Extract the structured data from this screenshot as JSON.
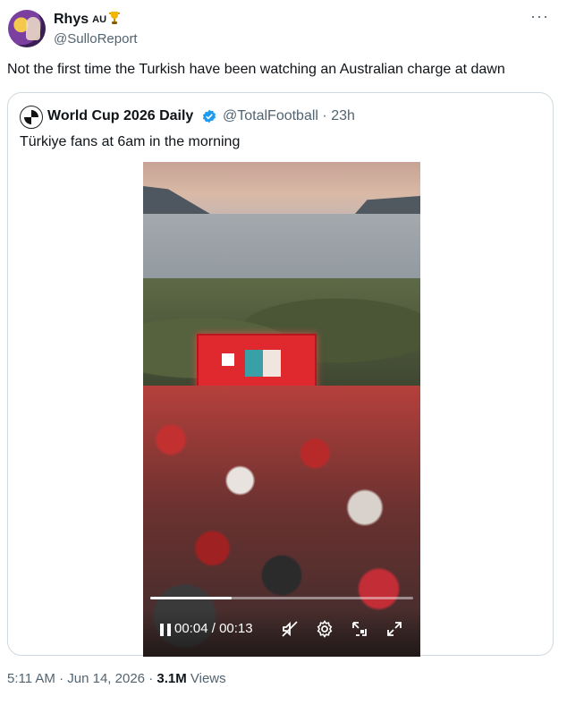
{
  "author": {
    "name": "Rhys",
    "country": "AU",
    "handle": "@SulloReport"
  },
  "tweet": {
    "text": "Not the first time the Turkish have been watching an Australian charge at dawn"
  },
  "quoted": {
    "name": "World Cup 2026 Daily",
    "handle": "@TotalFootball",
    "separator": "·",
    "age": "23h",
    "text": "Türkiye fans at 6am in the morning"
  },
  "video": {
    "current_time": "00:04",
    "time_separator": "/",
    "duration": "00:13",
    "progress": 0.31,
    "icons": [
      "pause-icon",
      "mute-icon",
      "settings-icon",
      "pip-icon",
      "fullscreen-icon"
    ]
  },
  "footer": {
    "time": "5:11 AM",
    "dot1": "·",
    "date": "Jun 14, 2026",
    "dot2": "·",
    "views_count": "3.1M",
    "views_label": "Views"
  },
  "colors": {
    "text_primary": "#0f1419",
    "text_secondary": "#536471",
    "border": "#cfd9de",
    "verified": "#1d9bf0"
  }
}
